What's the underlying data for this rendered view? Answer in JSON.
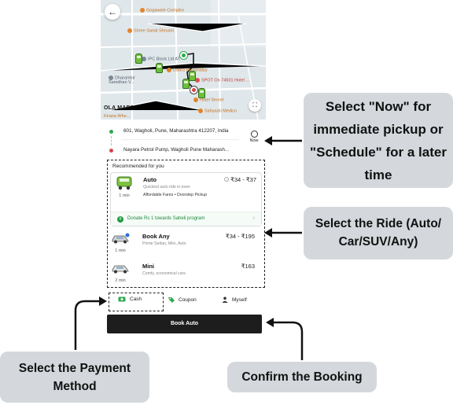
{
  "map": {
    "back_icon": "arrow-left-icon",
    "pois": {
      "gogawale": "Gogawale Complex",
      "shree_sant": "Shree Sanat Shrvani",
      "ipc_block": "IPC Block Ltd AT",
      "bhojanalay": "Dadra Bhojanalay",
      "dharambir": "Dharambir Samdhan V...",
      "spot_on": "SPOT On 74501 Hotel ...",
      "hotel_secret": "Hotel Secret",
      "sahyadri": "Sahyadri Medico",
      "kirana": "Kirana Who..."
    },
    "branding": "OLA MAPS",
    "expand_icon": "expand-icon"
  },
  "locations": {
    "pickup": "601, Wagholi, Pune, Maharashtra 412207, India",
    "drop": "Nayara Petrol Pump, Wagholi Pune Maharash...",
    "schedule_label": "Now",
    "schedule_icon": "alarm-clock-icon"
  },
  "rides": {
    "section_title": "Recommended for you",
    "items": [
      {
        "name": "Auto",
        "description": "Quickest auto ride in town",
        "tags": "Affordable Fares • Doorstep Pickup",
        "price": "₹34 - ₹37",
        "eta": "1 min",
        "icon": "auto-rickshaw-icon"
      },
      {
        "name": "Book Any",
        "description": "Prime Sedan, Mini, Auto",
        "price": "₹34 - ₹195",
        "eta": "1 min",
        "icon": "car-icon"
      },
      {
        "name": "Mini",
        "description": "Comfy, economical cars",
        "price": "₹163",
        "eta": "2 min",
        "icon": "car-icon"
      }
    ],
    "donation": "Donate Rs 1 towards Saheli program"
  },
  "payment": {
    "cash": "Cash",
    "coupon": "Coupon",
    "rider": "Myself"
  },
  "book_button": "Book Auto",
  "callouts": {
    "now": "Select \"Now\" for immediate pickup or \"Schedule\" for a later time",
    "ride": "Select the Ride (Auto/ Car/SUV/Any)",
    "payment": "Select the Payment Method",
    "confirm": "Confirm the Booking"
  },
  "colors": {
    "accent_green": "#1f9d45",
    "button_dark": "#1d1d1d",
    "callout_bg": "#d4d8dc"
  }
}
